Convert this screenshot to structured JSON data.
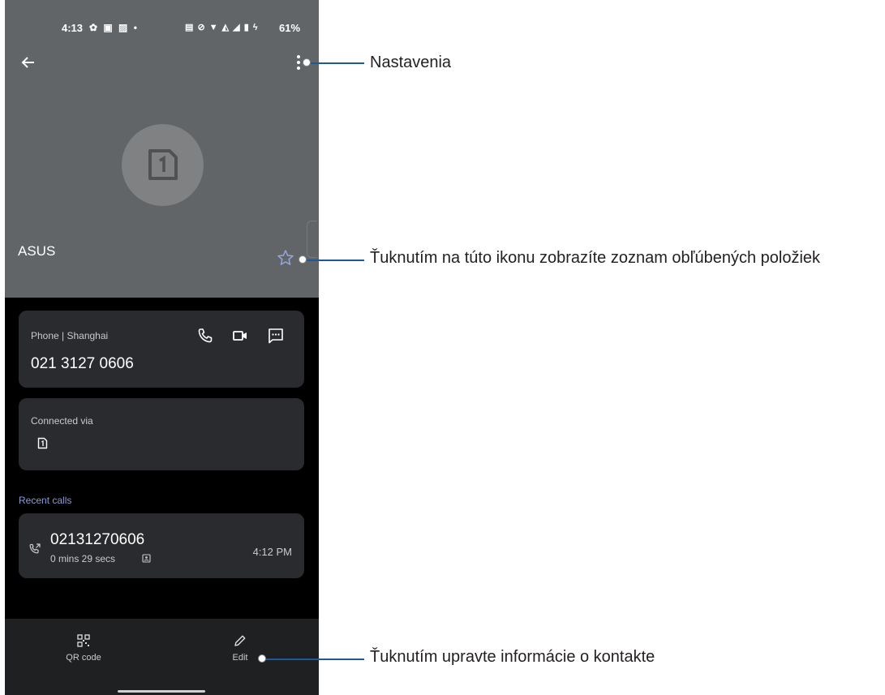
{
  "status_bar": {
    "time": "4:13",
    "left_icons": "✿ ▣ ▨ •",
    "right_icons": "▤ ⊘ ▼ ◭ ◢ ▮ ϟ",
    "battery": "61%"
  },
  "header": {
    "back_icon": "arrow-left-icon",
    "more_icon": "more-vertical-icon",
    "avatar_icon": "sim-card-1-icon",
    "contact_name": "ASUS",
    "favorite_icon": "star-outline-icon"
  },
  "phone_card": {
    "label": "Phone | Shanghai",
    "number": "021 3127 0606",
    "actions": [
      "phone-call-icon",
      "video-call-icon",
      "message-icon"
    ]
  },
  "via_card": {
    "label": "Connected via",
    "sim_icon": "sim-card-1-icon",
    "sim_slot": "1"
  },
  "recent_calls": {
    "title": "Recent calls",
    "items": [
      {
        "number": "02131270606",
        "duration": "0 mins 29 secs",
        "time": "4:12 PM",
        "direction_icon": "outgoing-call-icon"
      }
    ]
  },
  "bottom_bar": {
    "qr_label": "QR code",
    "edit_label": "Edit"
  },
  "callouts": {
    "settings": "Nastavenia",
    "favorites": "Ťuknutím na túto ikonu zobrazíte zoznam obľúbených položiek",
    "edit": "Ťuknutím upravte informácie o kontakte"
  },
  "colors": {
    "header_bg": "#626567",
    "card_bg": "#2a2b2e",
    "accent": "#8c9bd9",
    "callout_line": "#1b5a96"
  }
}
